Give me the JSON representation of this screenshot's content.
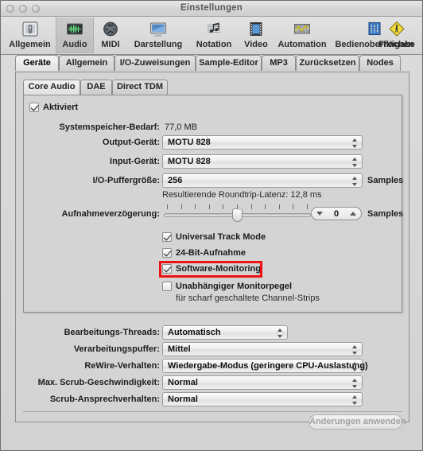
{
  "window": {
    "title": "Einstellungen",
    "traffic_lights": [
      "close",
      "minimize",
      "zoom"
    ]
  },
  "toolbar": {
    "items": [
      {
        "label": "Allgemein",
        "icon": "general-icon",
        "selected": false
      },
      {
        "label": "Audio",
        "icon": "waveform-icon",
        "selected": true
      },
      {
        "label": "MIDI",
        "icon": "midi-din-icon",
        "selected": false
      },
      {
        "label": "Darstellung",
        "icon": "display-icon",
        "selected": false
      },
      {
        "label": "Notation",
        "icon": "notes-icon",
        "selected": false
      },
      {
        "label": "Video",
        "icon": "film-icon",
        "selected": false
      },
      {
        "label": "Automation",
        "icon": "automation-icon",
        "selected": false
      },
      {
        "label": "Bedienoberflächen",
        "icon": "faders-icon",
        "selected": false
      },
      {
        "label": "Freigabe",
        "icon": "sharing-icon",
        "selected": false
      }
    ]
  },
  "outer_tabs": {
    "selected": "Geräte",
    "items": [
      {
        "label": "Geräte"
      },
      {
        "label": "Allgemein"
      },
      {
        "label": "I/O-Zuweisungen"
      },
      {
        "label": "Sample-Editor"
      },
      {
        "label": "MP3"
      },
      {
        "label": "Zurücksetzen"
      },
      {
        "label": "Nodes"
      }
    ]
  },
  "inner_tabs": {
    "selected": "Core Audio",
    "items": [
      {
        "label": "Core Audio"
      },
      {
        "label": "DAE"
      },
      {
        "label": "Direct TDM"
      }
    ]
  },
  "core_audio": {
    "enabled_checkbox": {
      "label": "Aktiviert",
      "checked": true
    },
    "memory": {
      "label": "Systemspeicher-Bedarf:",
      "value": "77,0 MB"
    },
    "output_device": {
      "label": "Output-Gerät:",
      "value": "MOTU 828"
    },
    "input_device": {
      "label": "Input-Gerät:",
      "value": "MOTU 828"
    },
    "io_buffer": {
      "label": "I/O-Puffergröße:",
      "value": "256",
      "unit": "Samples"
    },
    "latency_note": "Resultierende Roundtrip-Latenz: 12,8 ms",
    "record_delay": {
      "label": "Aufnahmeverzögerung:",
      "value": "0",
      "unit": "Samples",
      "slider_percent": 50,
      "tick_count": 11
    },
    "checkboxes": [
      {
        "label": "Universal Track Mode",
        "checked": true,
        "highlighted": false
      },
      {
        "label": "24-Bit-Aufnahme",
        "checked": true,
        "highlighted": false
      },
      {
        "label": "Software-Monitoring",
        "checked": true,
        "highlighted": true
      },
      {
        "label": "Unabhängiger Monitorpegel",
        "checked": false,
        "highlighted": false
      }
    ],
    "monitor_sublabel": "für scharf geschaltete Channel-Strips"
  },
  "performance": {
    "rows": [
      {
        "label": "Bearbeitungs-Threads:",
        "value": "Automatisch"
      },
      {
        "label": "Verarbeitungspuffer:",
        "value": "Mittel"
      },
      {
        "label": "ReWire-Verhalten:",
        "value": "Wiedergabe-Modus (geringere CPU-Auslastung)"
      },
      {
        "label": "Max. Scrub-Geschwindigkeit:",
        "value": "Normal"
      },
      {
        "label": "Scrub-Ansprechverhalten:",
        "value": "Normal"
      }
    ]
  },
  "footer": {
    "apply_button": "Änderungen anwenden",
    "apply_enabled": false
  },
  "colors": {
    "highlight": "#ee1111",
    "window_bg": "#d4d4d4",
    "toolbar_selected": "#c5c5c5"
  }
}
